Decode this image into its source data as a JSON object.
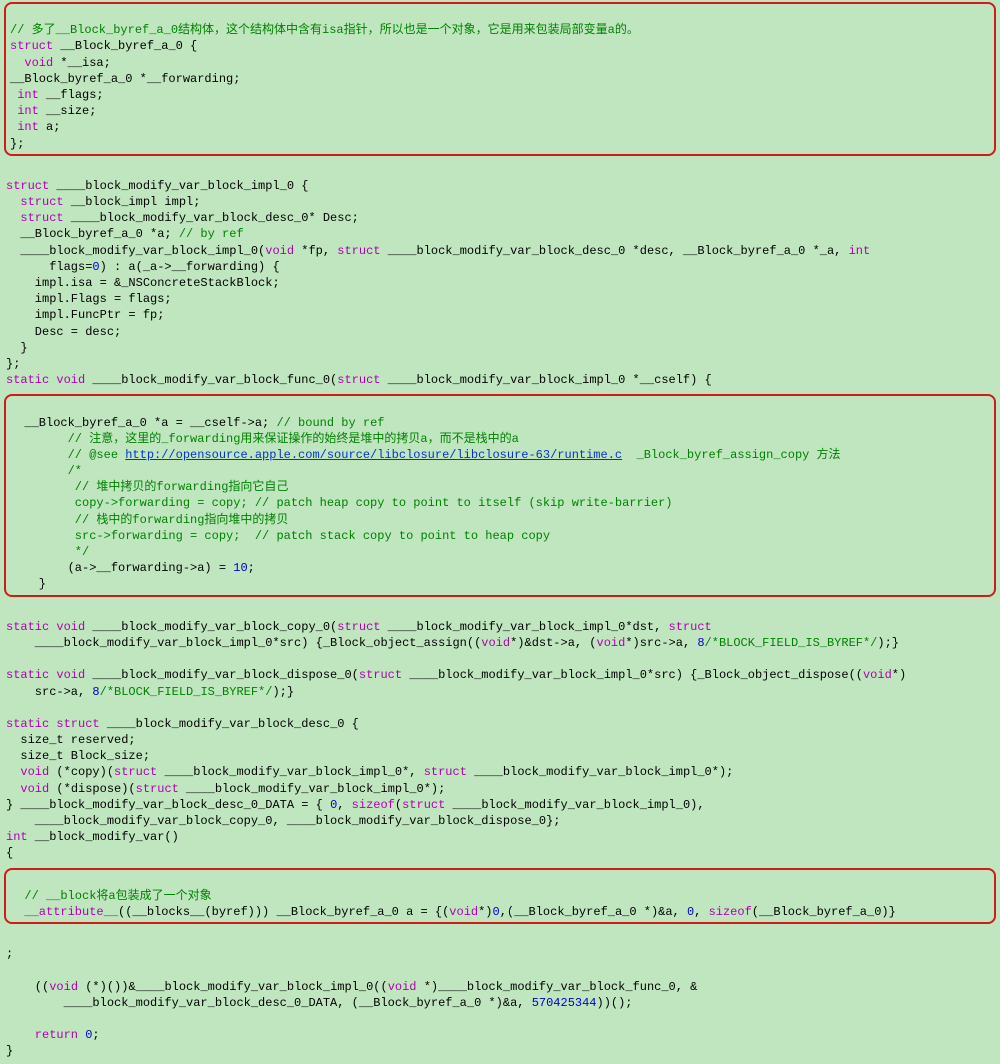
{
  "box1": {
    "c1": "// 多了__Block_byref_a_0结构体，这个结构体中含有isa指针，所以也是一个对象，它是用来包装局部变量a的。",
    "l1a": "struct",
    "l1b": " __Block_byref_a_0 {",
    "l2a": "  void",
    "l2b": " *__isa;",
    "l3": "__Block_byref_a_0 *__forwarding;",
    "l4a": " int",
    "l4b": " __flags;",
    "l5a": " int",
    "l5b": " __size;",
    "l6a": " int",
    "l6b": " a;",
    "l7": "};"
  },
  "mid1": {
    "l1a": "struct",
    "l1b": " ____block_modify_var_block_impl_0 {",
    "l2a": "  struct",
    "l2b": " __block_impl impl;",
    "l3a": "  struct",
    "l3b": " ____block_modify_var_block_desc_0* Desc;",
    "l4a": "  __Block_byref_a_0 *a; ",
    "l4b": "// by ref",
    "l5a": "  ____block_modify_var_block_impl_0(",
    "l5b": "void",
    "l5c": " *fp, ",
    "l5d": "struct",
    "l5e": " ____block_modify_var_block_desc_0 *desc, __Block_byref_a_0 *_a, ",
    "l5f": "int",
    "l5g": "      flags=",
    "l5h": "0",
    "l5i": ") : a(_a->__forwarding) {",
    "l6": "    impl.isa = &_NSConcreteStackBlock;",
    "l7": "    impl.Flags = flags;",
    "l8": "    impl.FuncPtr = fp;",
    "l9": "    Desc = desc;",
    "l10": "  }",
    "l11": "};",
    "l12a": "static void",
    "l12b": " ____block_modify_var_block_func_0(",
    "l12c": "struct",
    "l12d": " ____block_modify_var_block_impl_0 *__cself) {"
  },
  "box2": {
    "l1a": "  __Block_byref_a_0 *a = __cself->a; ",
    "l1b": "// bound by ref",
    "c1": "        // 注意，这里的_forwarding用来保证操作的始终是堆中的拷贝a，而不是栈中的a",
    "c2a": "        // @see ",
    "link": "http://opensource.apple.com/source/libclosure/libclosure-63/runtime.c",
    "c2b": "  _Block_byref_assign_copy 方法",
    "c3": "        /*",
    "c4": "         // 堆中拷贝的forwarding指向它自己",
    "c5": "         copy->forwarding = copy; // patch heap copy to point to itself (skip write-barrier)",
    "c6": "         // 栈中的forwarding指向堆中的拷贝",
    "c7": "         src->forwarding = copy;  // patch stack copy to point to heap copy",
    "c8": "         */",
    "l2a": "        (a->__forwarding->a) = ",
    "l2b": "10",
    "l2c": ";",
    "l3": "    }"
  },
  "mid2": {
    "l1a": "static void",
    "l1b": " ____block_modify_var_block_copy_0(",
    "l1c": "struct",
    "l1d": " ____block_modify_var_block_impl_0*dst, ",
    "l1e": "struct",
    "l2a": "    ____block_modify_var_block_impl_0*src) {_Block_object_assign((",
    "l2b": "void",
    "l2c": "*)&dst->a, (",
    "l2d": "void",
    "l2e": "*)src->a, ",
    "l2f": "8",
    "l2g": "/*BLOCK_FIELD_IS_BYREF*/",
    "l2h": ");}",
    "sp1": "",
    "l3a": "static void",
    "l3b": " ____block_modify_var_block_dispose_0(",
    "l3c": "struct",
    "l3d": " ____block_modify_var_block_impl_0*src) {_Block_object_dispose((",
    "l3e": "void",
    "l3f": "*)",
    "l4a": "    src->a, ",
    "l4b": "8",
    "l4c": "/*BLOCK_FIELD_IS_BYREF*/",
    "l4d": ");}",
    "sp2": "",
    "l5a": "static struct",
    "l5b": " ____block_modify_var_block_desc_0 {",
    "l6": "  size_t reserved;",
    "l7": "  size_t Block_size;",
    "l8a": "  void",
    "l8b": " (*copy)(",
    "l8c": "struct",
    "l8d": " ____block_modify_var_block_impl_0*, ",
    "l8e": "struct",
    "l8f": " ____block_modify_var_block_impl_0*);",
    "l9a": "  void",
    "l9b": " (*dispose)(",
    "l9c": "struct",
    "l9d": " ____block_modify_var_block_impl_0*);",
    "l10a": "} ____block_modify_var_block_desc_0_DATA = { ",
    "l10b": "0",
    "l10c": ", ",
    "l10d": "sizeof",
    "l10e": "(",
    "l10f": "struct",
    "l10g": " ____block_modify_var_block_impl_0),",
    "l11": "    ____block_modify_var_block_copy_0, ____block_modify_var_block_dispose_0};",
    "l12a": "int",
    "l12b": " __block_modify_var()",
    "l13": "{"
  },
  "box3": {
    "c1": "  // __block将a包装成了一个对象",
    "l1a": "  __attribute__",
    "l1b": "((__blocks__(byref))) __Block_byref_a_0 a = {(",
    "l1c": "void",
    "l1d": "*)",
    "l1e": "0",
    "l1f": ",(__Block_byref_a_0 *)&a, ",
    "l1g": "0",
    "l1h": ", ",
    "l1i": "sizeof",
    "l1j": "(__Block_byref_a_0)}"
  },
  "mid3": {
    "l0": ";",
    "sp1": "",
    "l1a": "    ((",
    "l1b": "void",
    "l1c": " (*)())&____block_modify_var_block_impl_0((",
    "l1d": "void",
    "l1e": " *)____block_modify_var_block_func_0, &",
    "l2a": "        ____block_modify_var_block_desc_0_DATA, (__Block_byref_a_0 *)&a, ",
    "l2b": "570425344",
    "l2c": "))();",
    "sp2": "",
    "l3a": "    return ",
    "l3b": "0",
    "l3c": ";",
    "l4": "}"
  }
}
